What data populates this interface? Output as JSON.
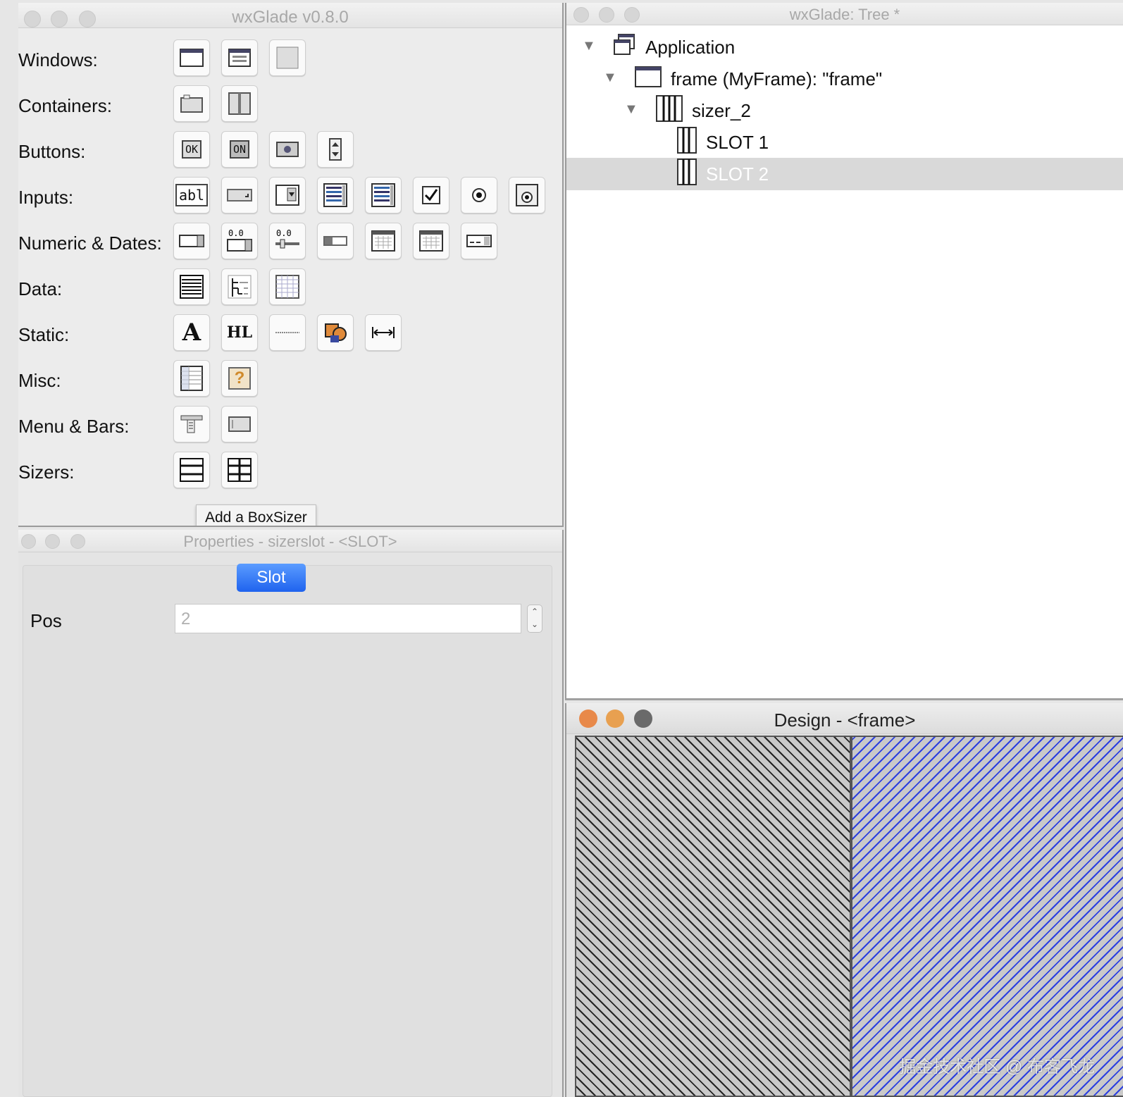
{
  "palette": {
    "title": "wxGlade v0.8.0",
    "rows": [
      {
        "label": "Windows:",
        "tools": [
          "frame-icon",
          "dialog-icon",
          "panel-icon"
        ]
      },
      {
        "label": "Containers:",
        "tools": [
          "notebook-icon",
          "splitter-icon"
        ]
      },
      {
        "label": "Buttons:",
        "tools": [
          "ok-button-icon",
          "toggle-button-icon",
          "bitmap-button-icon",
          "spin-button-icon"
        ]
      },
      {
        "label": "Inputs:",
        "tools": [
          "text-ctrl-icon",
          "combo-box-icon",
          "choice-icon",
          "list-box-icon",
          "check-list-box-icon",
          "checkbox-icon",
          "radio-button-icon",
          "radio-box-icon"
        ]
      },
      {
        "label": "Numeric & Dates:",
        "tools": [
          "spin-ctrl-icon",
          "spin-ctrl-double-icon",
          "slider-icon",
          "gauge-icon",
          "calendar-icon",
          "generic-calendar-icon",
          "date-picker-icon"
        ]
      },
      {
        "label": "Data:",
        "tools": [
          "list-ctrl-icon",
          "tree-ctrl-icon",
          "grid-icon"
        ]
      },
      {
        "label": "Static:",
        "tools": [
          "static-text-icon",
          "hyperlink-icon",
          "static-line-icon",
          "static-bitmap-icon",
          "spacer-icon"
        ]
      },
      {
        "label": "Misc:",
        "tools": [
          "property-grid-icon",
          "custom-widget-icon"
        ]
      },
      {
        "label": "Menu & Bars:",
        "tools": [
          "menubar-icon",
          "toolbar-icon"
        ]
      },
      {
        "label": "Sizers:",
        "tools": [
          "box-sizer-icon",
          "grid-sizer-icon"
        ]
      }
    ],
    "button_texts": {
      "ok": "OK",
      "on": "ON",
      "abl": "abl",
      "num": "0.0",
      "hl": "HL",
      "a": "A",
      "q": "?"
    },
    "tooltip": "Add a BoxSizer"
  },
  "properties": {
    "title": "Properties - sizerslot - <SLOT>",
    "tab": "Slot",
    "pos_label": "Pos",
    "pos_value": "2"
  },
  "tree": {
    "title": "wxGlade: Tree *",
    "nodes": [
      {
        "label": "Application",
        "icon": "application-icon",
        "expanded": true
      },
      {
        "label": "frame (MyFrame): \"frame\"",
        "icon": "frame-icon",
        "expanded": true
      },
      {
        "label": "sizer_2",
        "icon": "sizer-icon",
        "expanded": true
      },
      {
        "label": "SLOT 1",
        "icon": "slot-icon"
      },
      {
        "label": "SLOT 2",
        "icon": "slot-icon",
        "selected": true
      }
    ]
  },
  "design": {
    "title": "Design - <frame>",
    "watermark": "掘金技术社区 @ 布客飞龙",
    "colors": {
      "close": "#e8894a",
      "minimize": "#e8a050",
      "zoom": "#6a6a6a",
      "selected_slot": "#2b3ee0"
    }
  }
}
